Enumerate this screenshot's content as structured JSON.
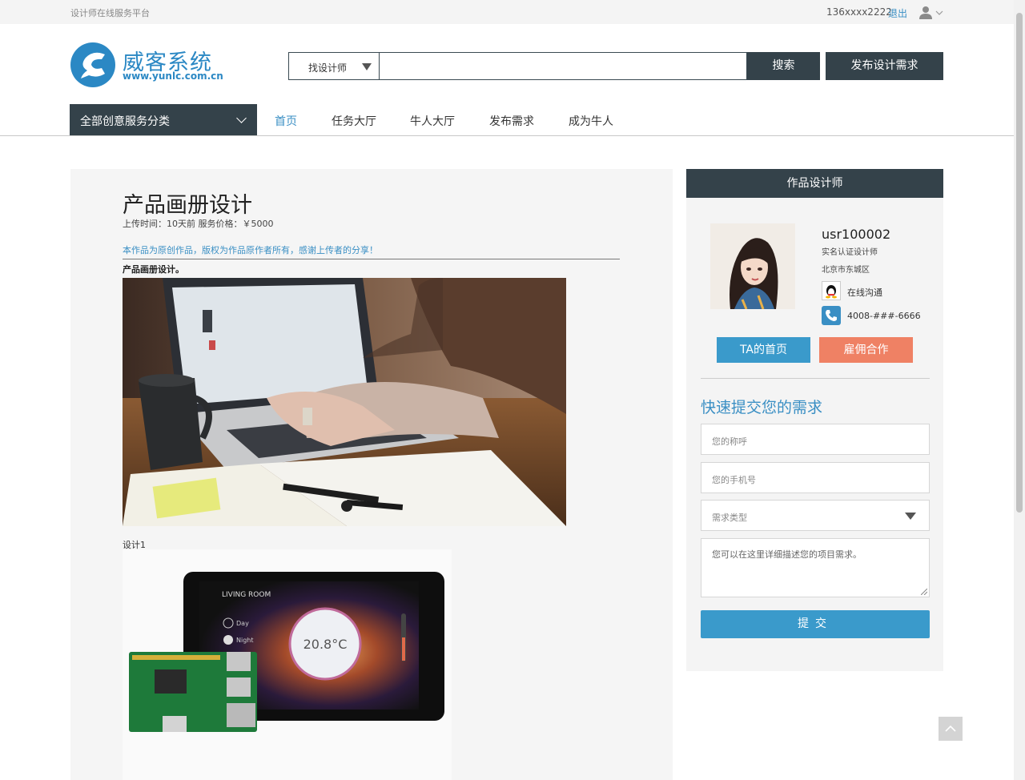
{
  "topbar": {
    "slogan": "设计师在线服务平台",
    "phone": "136xxxx2222",
    "logout": "退出",
    "user_icon": "user-icon"
  },
  "logo": {
    "name": "威客系统",
    "url": "www.yunlc.com.cn"
  },
  "search": {
    "type_selected": "找设计师",
    "input_value": "",
    "button": "搜索"
  },
  "header": {
    "publish_button": "发布设计需求"
  },
  "nav": {
    "category_button": "全部创意服务分类",
    "items": [
      "首页",
      "任务大厅",
      "牛人大厅",
      "发布需求",
      "成为牛人"
    ],
    "active_index": 0
  },
  "work": {
    "title": "产品画册设计",
    "meta": "上传时间：10天前 服务价格：￥5000",
    "notice": "本作品为原创作品，版权为作品原作者所有，感谢上传者的分享！",
    "description": "产品画册设计。",
    "image_caption": "设计1",
    "screen": {
      "room_label": "LIVING ROOM",
      "day_label": "Day",
      "night_label": "Night",
      "temperature": "20.8°C"
    }
  },
  "sidebar": {
    "heading": "作品设计师",
    "designer": {
      "name": "usr100002",
      "certification": "实名认证设计师",
      "location": "北京市东城区",
      "qq_label": "在线沟通",
      "phone": "4008-###-6666"
    },
    "ta_home_button": "TA的首页",
    "hire_button": "雇佣合作",
    "quick_title": "快速提交您的需求",
    "form": {
      "name_placeholder": "您的称呼",
      "phone_placeholder": "您的手机号",
      "type_placeholder": "需求类型",
      "detail_placeholder": "您可以在这里详细描述您的项目需求。",
      "submit": "提交"
    }
  },
  "colors": {
    "dark": "#34424a",
    "accent_blue": "#3a9acb",
    "link_blue": "#3a8fc4",
    "hire_orange": "#ef8164"
  }
}
